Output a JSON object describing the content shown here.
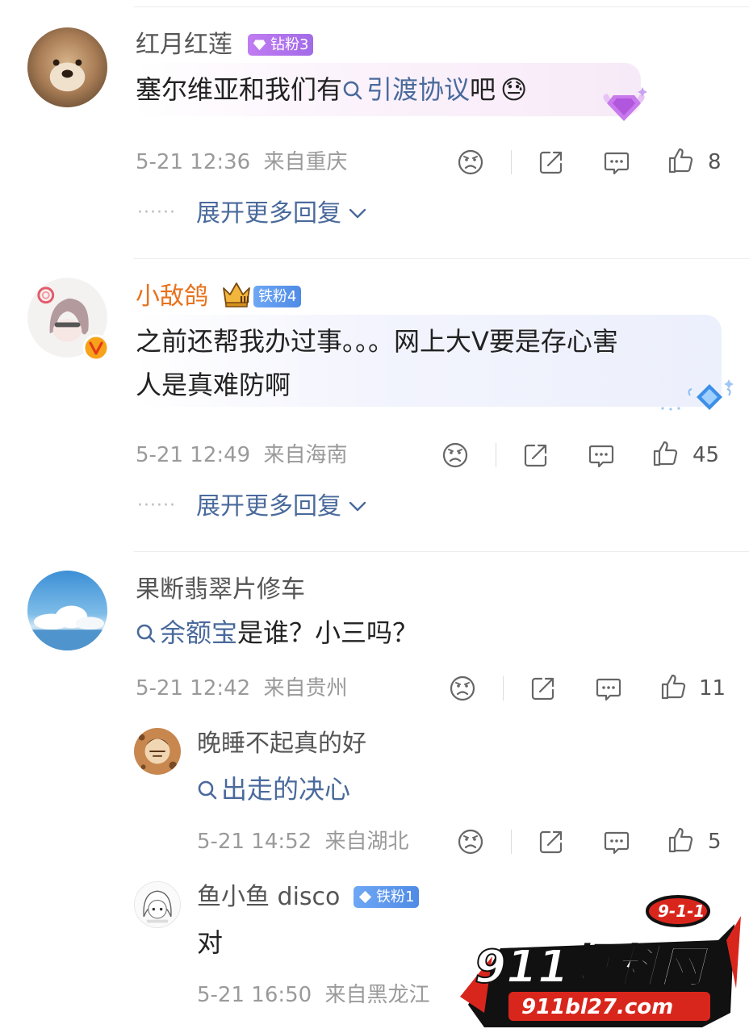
{
  "comments": [
    {
      "username": "红月红莲",
      "badge": "钻粉3",
      "text_prefix": "塞尔维亚和我们有",
      "link_text": "引渡协议",
      "text_suffix": "吧",
      "emoji": "😓",
      "time": "5-21 12:36",
      "location": "来自重庆",
      "likes": "8",
      "expand_label": "展开更多回复",
      "expand_dots": "······"
    },
    {
      "username": "小敌鸽",
      "badge": "铁粉4",
      "text_line1": "之前还帮我办过事。。。网上大V要是存心害",
      "text_line2": "人是真难防啊",
      "time": "5-21 12:49",
      "location": "来自海南",
      "likes": "45",
      "expand_label": "展开更多回复",
      "expand_dots": "······"
    },
    {
      "username": "果断翡翠片修车",
      "link_text": "余额宝",
      "text_suffix": "是谁？小三吗？",
      "time": "5-21 12:42",
      "location": "来自贵州",
      "likes": "11",
      "replies": [
        {
          "username": "晚睡不起真的好",
          "link_text": "出走的决心",
          "time": "5-21 14:52",
          "location": "来自湖北",
          "likes": "5"
        },
        {
          "username": "鱼小鱼 disco",
          "badge": "铁粉1",
          "text": "对",
          "time": "5-21 16:50",
          "location": "来自黑龙江"
        }
      ]
    }
  ],
  "watermark": {
    "brand": "911爆料网",
    "badge": "9-1-1",
    "url": "911bl27.com"
  },
  "colors": {
    "link": "#4a6a9c",
    "username_orange": "#e8721d",
    "badge_purple": "#a26be8",
    "badge_blue": "#4f8be6",
    "meta_gray": "#9a9a9a"
  },
  "icons": [
    "dislike-face-icon",
    "share-icon",
    "comment-icon",
    "like-thumb-icon",
    "search-icon",
    "chevron-down-icon",
    "diamond-icon",
    "crown-icon"
  ]
}
